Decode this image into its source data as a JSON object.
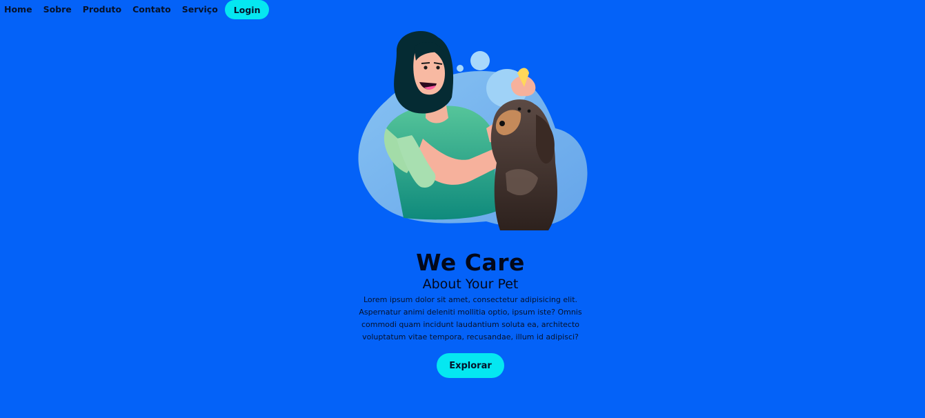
{
  "nav": {
    "items": [
      {
        "label": "Home",
        "name": "nav-home"
      },
      {
        "label": "Sobre",
        "name": "nav-sobre"
      },
      {
        "label": "Produto",
        "name": "nav-produto"
      },
      {
        "label": "Contato",
        "name": "nav-contato"
      },
      {
        "label": "Serviço",
        "name": "nav-servico"
      }
    ],
    "login_label": "Login"
  },
  "hero": {
    "title": "We Care",
    "subtitle": "About Your Pet",
    "text": "Lorem ipsum dolor sit amet, consectetur adipisicing elit. Aspernatur animi deleniti mollitia optio, ipsum iste? Omnis commodi quam incidunt laudantium soluta ea, architecto voluptatum vitae tempora, recusandae, illum id adipisci?",
    "button_label": "Explorar"
  },
  "colors": {
    "background": "#0462f8",
    "accent": "#05e7f1",
    "text": "#03081a"
  },
  "illustration": {
    "icon": "woman-petting-dog-illustration"
  }
}
